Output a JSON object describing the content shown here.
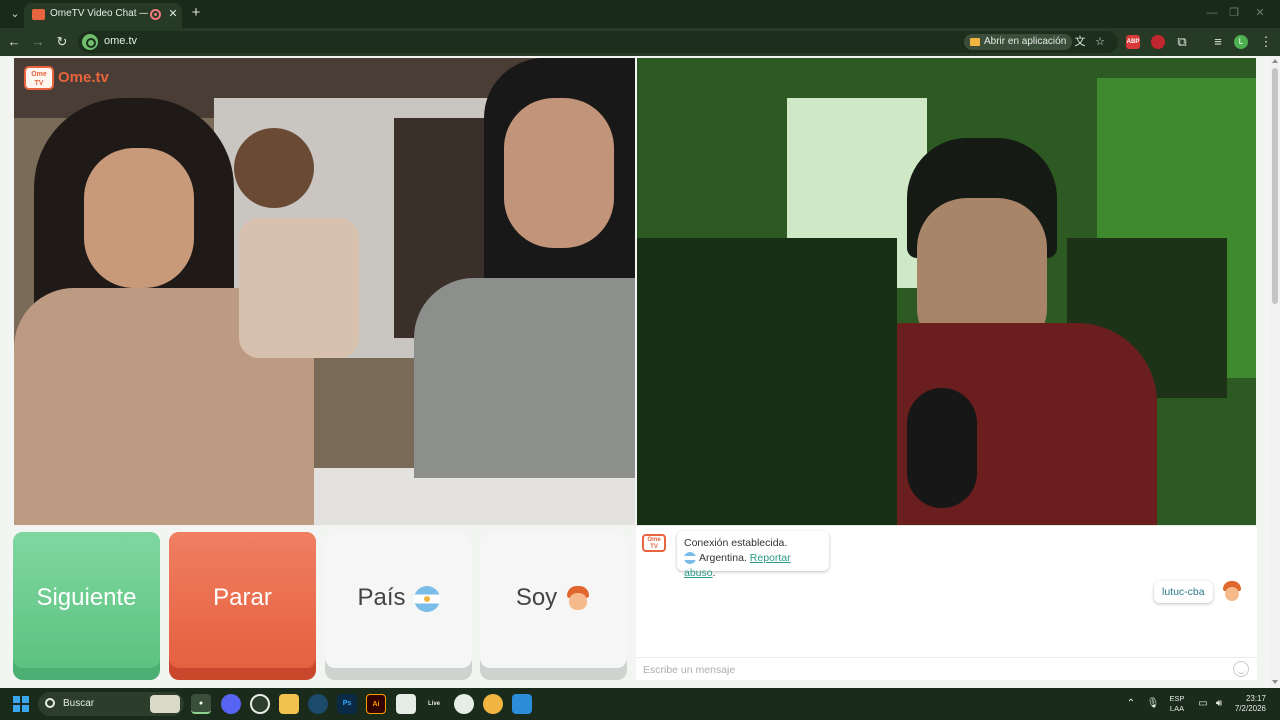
{
  "browser": {
    "tab_title": "OmeTV Video Chat — Ome",
    "tab_list_icon": "chevron-down-icon",
    "new_tab": "+",
    "url": "ome.tv",
    "open_in_app": "Abrir en aplicación",
    "profile_initial": "L",
    "extensions": [
      "ABP",
      "extension"
    ]
  },
  "logo": {
    "tv": "Ome TV",
    "word": "Ome.tv"
  },
  "buttons": {
    "next": "Siguiente",
    "stop": "Parar",
    "country": "País",
    "me": "Soy"
  },
  "chat": {
    "logo": "Ome TV",
    "connection": "Conexión establecida.",
    "country": "Argentina.",
    "report": "Reportar abuso",
    "report_suffix": ".",
    "partner_name": "lutuc-cba",
    "input_placeholder": "Escribe un mensaje"
  },
  "taskbar": {
    "search_text": "Buscar",
    "lang_1": "ESP",
    "lang_2": "LAA",
    "time": "23:17",
    "date": "7/2/2026",
    "apps": [
      "Ps",
      "Ai",
      "Live"
    ]
  },
  "colors": {
    "next": "#5dc281",
    "stop": "#e5603f",
    "brand": "#e7643f",
    "link": "#2b9a86"
  }
}
